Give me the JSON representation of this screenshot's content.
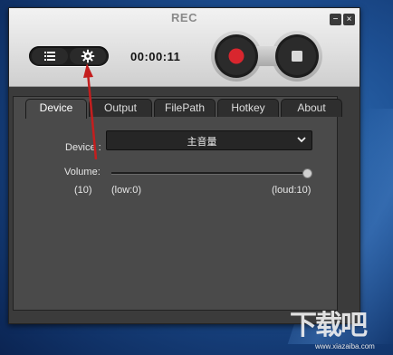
{
  "window": {
    "title": "REC",
    "minimize_label": "−",
    "close_label": "×"
  },
  "toolbar": {
    "timer": "00:00:11"
  },
  "tabs": [
    {
      "label": "Device",
      "active": true
    },
    {
      "label": "Output",
      "active": false
    },
    {
      "label": "FilePath",
      "active": false
    },
    {
      "label": "Hotkey",
      "active": false
    },
    {
      "label": "About",
      "active": false
    }
  ],
  "device": {
    "label": "Device :",
    "selected": "主音量"
  },
  "volume": {
    "label": "Volume:",
    "value_text": "(10)",
    "low_text": "(low:0)",
    "loud_text": "(loud:10)",
    "level": 1.0
  },
  "watermark": {
    "text": "下载吧",
    "url": "www.xiazaiba.com"
  },
  "colors": {
    "record_red": "#d8262e",
    "annotation_arrow": "#c41e1e"
  },
  "icons": {
    "list": "list-icon",
    "settings": "gear-icon",
    "record": "record-icon",
    "stop": "stop-icon",
    "dropdown": "chevron-down-icon"
  }
}
